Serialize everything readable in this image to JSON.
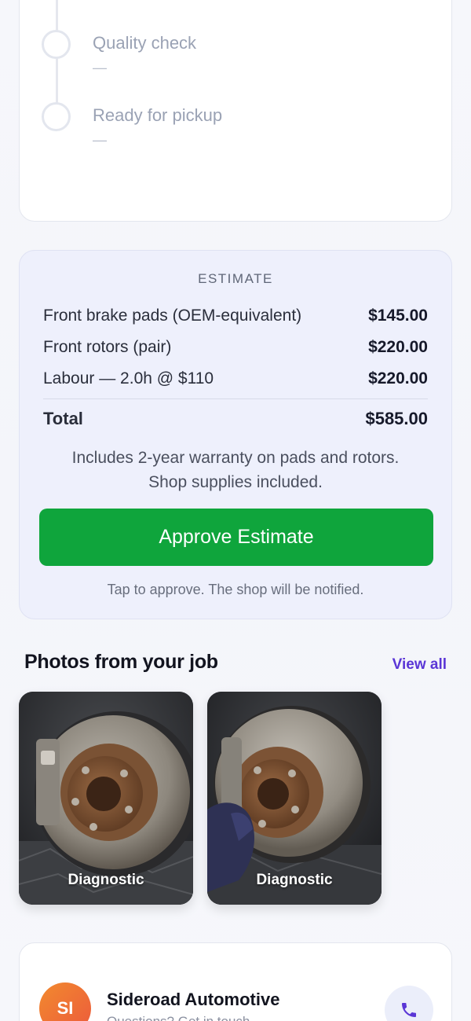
{
  "timeline": {
    "steps": [
      {
        "title": "Quality check",
        "detail": "—"
      },
      {
        "title": "Ready for pickup",
        "detail": "—"
      }
    ]
  },
  "estimate": {
    "heading": "ESTIMATE",
    "items": [
      {
        "label": "Front brake pads (OEM-equivalent)",
        "amount": "$145.00"
      },
      {
        "label": "Front rotors (pair)",
        "amount": "$220.00"
      },
      {
        "label": "Labour — 2.0h @ $110",
        "amount": "$220.00"
      }
    ],
    "total_label": "Total",
    "total_amount": "$585.00",
    "note_line1": "Includes 2-year warranty on pads and rotors.",
    "note_line2": "Shop supplies included.",
    "approve_label": "Approve Estimate",
    "approve_hint": "Tap to approve. The shop will be notified.",
    "approve_color": "#0fa53c"
  },
  "photos": {
    "title": "Photos from your job",
    "view_all": "View all",
    "items": [
      {
        "caption": "Diagnostic"
      },
      {
        "caption": "Diagnostic"
      }
    ]
  },
  "shop": {
    "initials": "SI",
    "name": "Sideroad Automotive",
    "subtitle": "Questions? Get in touch",
    "call_icon": "phone-icon",
    "accent": "#5a36d6"
  }
}
